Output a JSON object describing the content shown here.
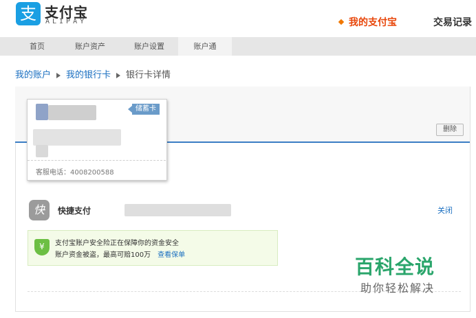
{
  "header": {
    "logo_glyph": "支",
    "logo_text": "支付宝",
    "logo_sub": "ALIPAY",
    "nav": [
      {
        "label": "我的支付宝",
        "active": true
      },
      {
        "label": "交易记录",
        "active": false
      }
    ]
  },
  "tabs": [
    {
      "label": "首页",
      "active": false
    },
    {
      "label": "账户资产",
      "active": false
    },
    {
      "label": "账户设置",
      "active": false
    },
    {
      "label": "账户通",
      "active": true
    }
  ],
  "breadcrumb": [
    {
      "label": "我的账户",
      "link": true
    },
    {
      "label": "我的银行卡",
      "link": true
    },
    {
      "label": "银行卡详情",
      "link": false
    }
  ],
  "card": {
    "type_badge": "储蓄卡",
    "service_phone": "客服电话：4008200588"
  },
  "actions": {
    "delete_label": "删除"
  },
  "quick_pay": {
    "icon_glyph": "快",
    "label": "快捷支付",
    "close_label": "关闭"
  },
  "notice": {
    "shield_glyph": "¥",
    "line1": "支付宝账户安全险正在保障你的资金安全",
    "line2": "账户资金被盗，最高可赔100万",
    "link": "查看保单"
  },
  "watermark": {
    "title": "百科全说",
    "subtitle": "助你轻松解决"
  },
  "colors": {
    "brand_blue": "#1a9fe3",
    "accent_orange": "#e8460a",
    "link_blue": "#1a6fc0",
    "badge_blue": "#6a9bc9",
    "success_green": "#6cbf43"
  }
}
